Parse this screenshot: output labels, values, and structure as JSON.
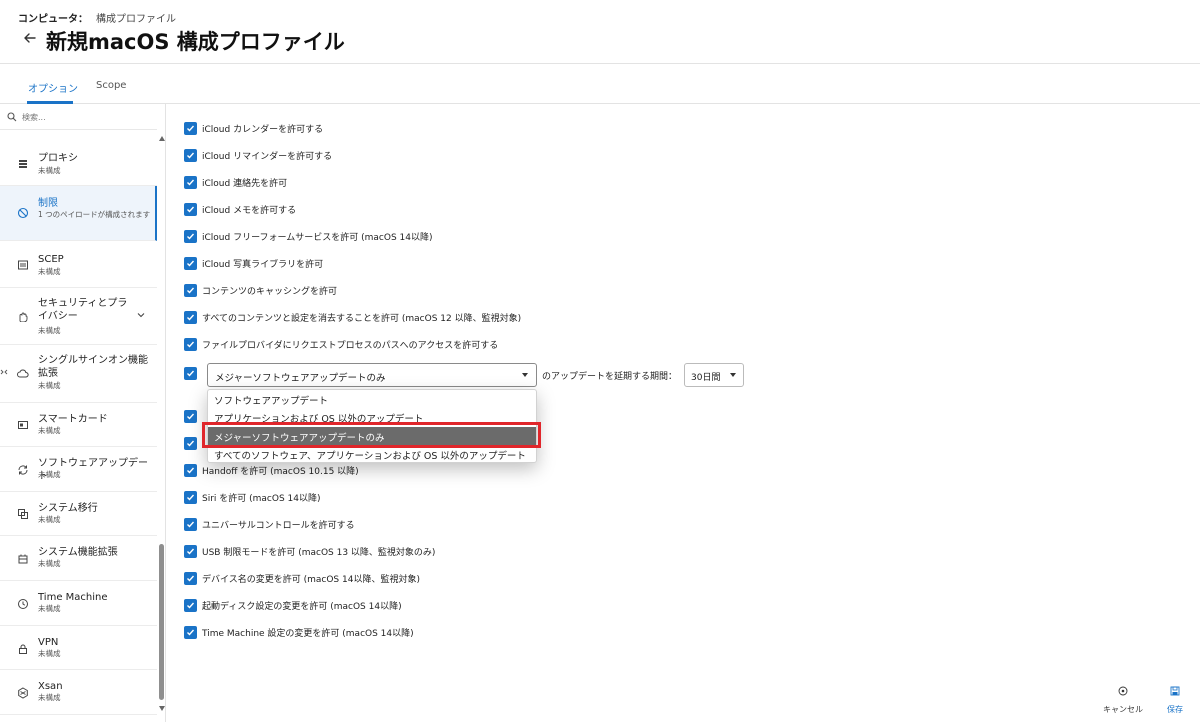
{
  "breadcrumb": {
    "root": "コンピュータ：",
    "current": "構成プロファイル"
  },
  "page_title": "新規macOS 構成プロファイル",
  "tabs": [
    {
      "label": "オプション",
      "active": true
    },
    {
      "label": "Scope",
      "active": false
    }
  ],
  "search": {
    "placeholder": "検索..."
  },
  "sidebar": {
    "items": [
      {
        "icon": "proxy-icon",
        "title": "プロキシ",
        "subtitle": "未構成",
        "active": false
      },
      {
        "icon": "restriction-icon",
        "title": "制限",
        "subtitle": "1 つのペイロードが構成されます",
        "active": true
      },
      {
        "icon": "certificate-icon",
        "title": "SCEP",
        "subtitle": "未構成",
        "active": false
      },
      {
        "icon": "security-hand-icon",
        "title": "セキュリティとプライバシー",
        "subtitle": "未構成",
        "active": false,
        "expandable": true
      },
      {
        "icon": "cloud-key-icon",
        "title": "シングルサインオン機能拡張",
        "subtitle": "未構成",
        "active": false
      },
      {
        "icon": "smart-card-icon",
        "title": "スマートカード",
        "subtitle": "未構成",
        "active": false
      },
      {
        "icon": "refresh-icon",
        "title": "ソフトウェアアップデート",
        "subtitle": "未構成",
        "active": false
      },
      {
        "icon": "migration-icon",
        "title": "システム移行",
        "subtitle": "未構成",
        "active": false
      },
      {
        "icon": "extension-icon",
        "title": "システム機能拡張",
        "subtitle": "未構成",
        "active": false
      },
      {
        "icon": "clock-icon",
        "title": "Time Machine",
        "subtitle": "未構成",
        "active": false
      },
      {
        "icon": "lock-icon",
        "title": "VPN",
        "subtitle": "未構成",
        "active": false
      },
      {
        "icon": "xsan-icon",
        "title": "Xsan",
        "subtitle": "未構成",
        "active": false
      }
    ]
  },
  "options": [
    {
      "label": "iCloud カレンダーを許可する",
      "checked": true
    },
    {
      "label": "iCloud リマインダーを許可する",
      "checked": true
    },
    {
      "label": "iCloud 連絡先を許可",
      "checked": true
    },
    {
      "label": "iCloud メモを許可する",
      "checked": true
    },
    {
      "label": "iCloud フリーフォームサービスを許可 (macOS 14以降)",
      "checked": true
    },
    {
      "label": "iCloud 写真ライブラリを許可",
      "checked": true
    },
    {
      "label": "コンテンツのキャッシングを許可",
      "checked": true
    },
    {
      "label": "すべてのコンテンツと設定を消去することを許可 (macOS 12 以降、監視対象)",
      "checked": true
    },
    {
      "label": "ファイルプロバイダにリクエストプロセスのパスへのアクセスを許可する",
      "checked": true
    }
  ],
  "deferral": {
    "checked": true,
    "selected": "メジャーソフトウェアアップデートのみ",
    "period_label": "のアップデートを延期する期間：",
    "period_value": "30日間",
    "dropdown_options": [
      "ソフトウェアアップデート",
      "アプリケーションおよび OS 以外のアップデート",
      "メジャーソフトウェアアップデートのみ",
      "すべてのソフトウェア、アプリケーションおよび OS 以外のアップデート"
    ],
    "selected_index": 2
  },
  "options_after": [
    {
      "label": "Handoff を許可 (macOS 10.15 以降)",
      "checked": true
    },
    {
      "label": "Siri を許可 (macOS 14以降)",
      "checked": true
    },
    {
      "label": "ユニバーサルコントロールを許可する",
      "checked": true
    },
    {
      "label": "USB 制限モードを許可 (macOS 13 以降、監視対象のみ)",
      "checked": true
    },
    {
      "label": "デバイス名の変更を許可 (macOS 14以降、監視対象)",
      "checked": true
    },
    {
      "label": "起動ディスク設定の変更を許可 (macOS 14以降)",
      "checked": true
    },
    {
      "label": "Time Machine 設定の変更を許可 (macOS 14以降)",
      "checked": true
    }
  ],
  "footer": {
    "cancel_label": "キャンセル",
    "save_label": "保存"
  },
  "colors": {
    "accent": "#1a73c7",
    "highlight": "#e0262b",
    "selected_option_bg": "#6b6b6b"
  }
}
